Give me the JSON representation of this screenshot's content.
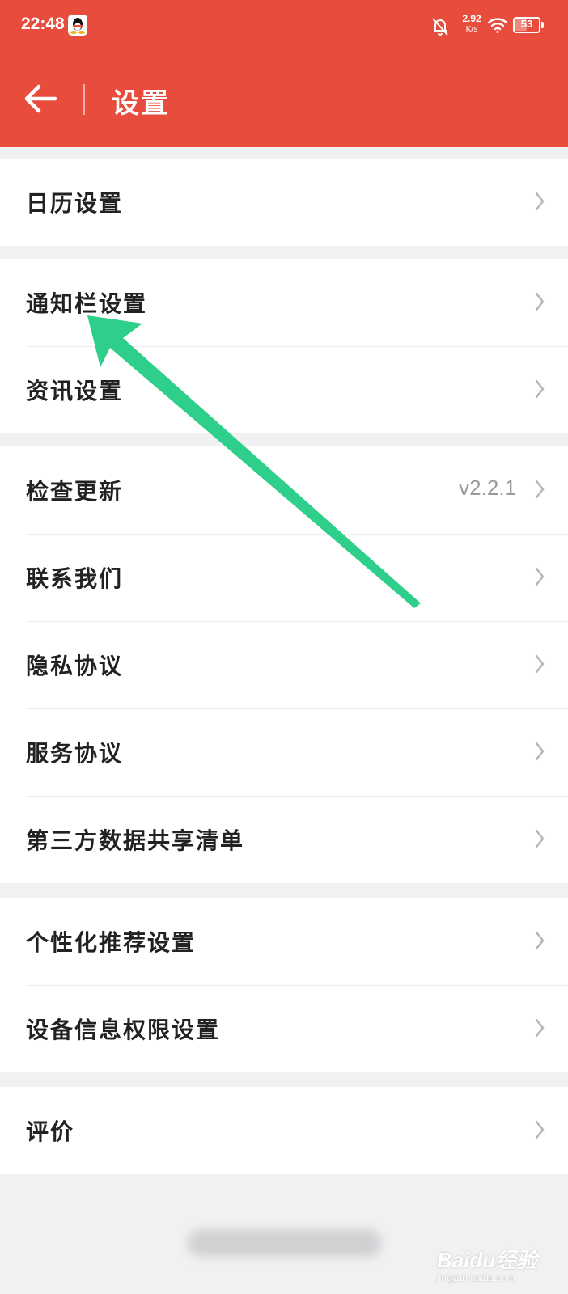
{
  "status_bar": {
    "time": "22:48",
    "net_speed": "2.92",
    "net_unit": "K/s",
    "battery": "53",
    "battery_level_percent": 53,
    "icons": [
      "qq-icon",
      "bell-muted-icon",
      "wifi-icon",
      "battery-icon"
    ]
  },
  "header": {
    "title": "设置",
    "back_icon": "arrow-left-icon",
    "background_color": "#e84c3d"
  },
  "groups": [
    {
      "items": [
        {
          "label": "日历设置"
        }
      ]
    },
    {
      "items": [
        {
          "label": "通知栏设置"
        },
        {
          "label": "资讯设置"
        }
      ]
    },
    {
      "items": [
        {
          "label": "检查更新",
          "value": "v2.2.1"
        },
        {
          "label": "联系我们"
        },
        {
          "label": "隐私协议"
        },
        {
          "label": "服务协议"
        },
        {
          "label": "第三方数据共享清单"
        }
      ]
    },
    {
      "items": [
        {
          "label": "个性化推荐设置"
        },
        {
          "label": "设备信息权限设置"
        }
      ]
    },
    {
      "items": [
        {
          "label": "评价"
        }
      ]
    }
  ],
  "annotation": {
    "color": "#2ecf8a",
    "icon": "green-arrow-annotation"
  },
  "watermark": {
    "logo": "Baidu经验",
    "url": "jingyan.baidu.com"
  }
}
